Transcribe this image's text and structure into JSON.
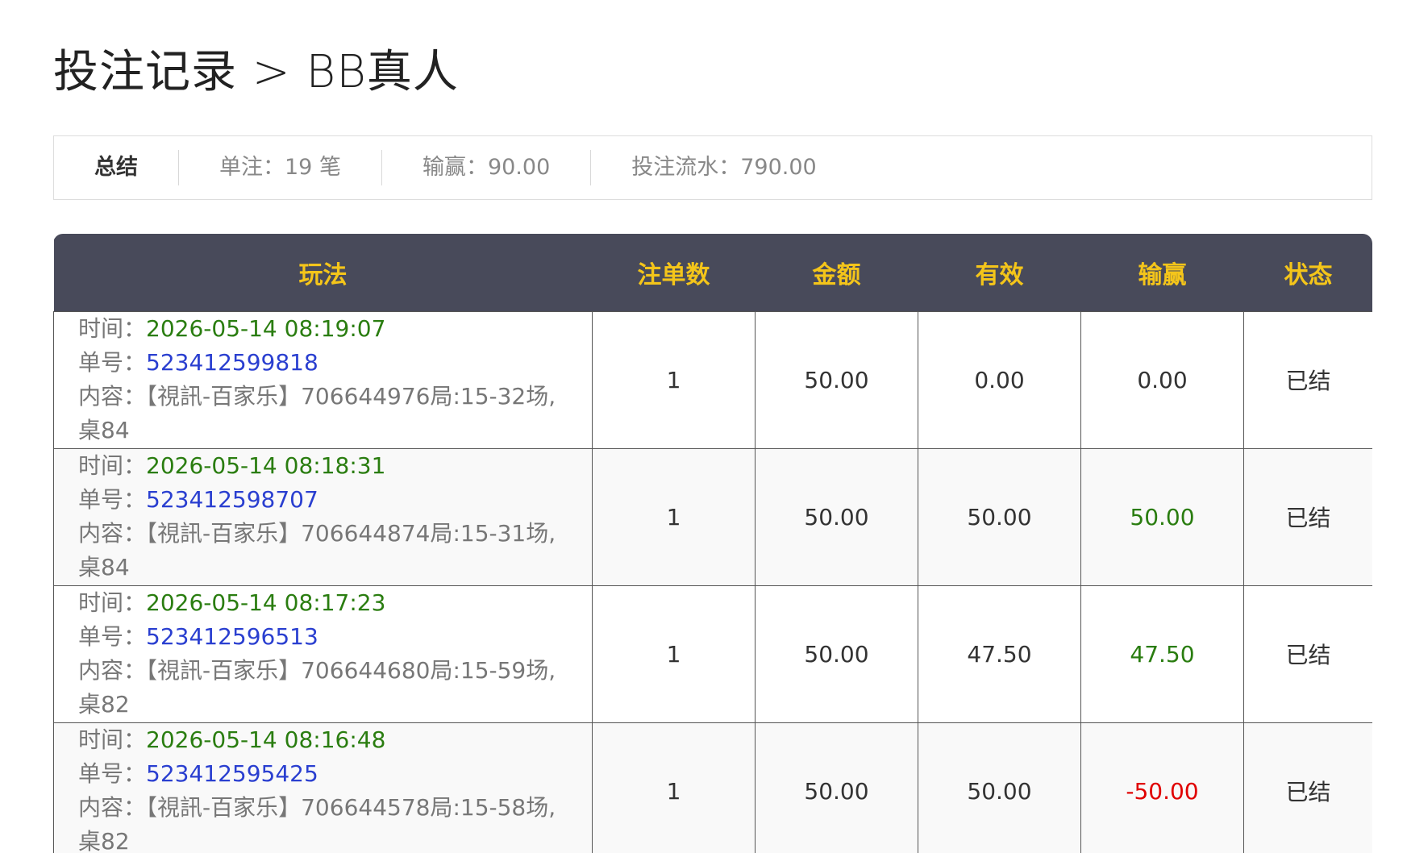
{
  "title": "投注记录 > BB真人",
  "summary": {
    "label": "总结",
    "count": "单注：19 笔",
    "winloss": "输赢：90.00",
    "turnover": "投注流水：790.00"
  },
  "table": {
    "headers": [
      "玩法",
      "注单数",
      "金额",
      "有效",
      "输赢",
      "状态"
    ],
    "time_label": "时间：",
    "no_label": "单号：",
    "content_label": "内容：",
    "rows": [
      {
        "time": "2026-05-14 08:19:07",
        "no": "523412599818",
        "content": "【視訊-百家乐】706644976局:15-32场,桌84",
        "count": "1",
        "amount": "50.00",
        "valid": "0.00",
        "winloss": "0.00",
        "winloss_color": "#333333",
        "status": "已结"
      },
      {
        "time": "2026-05-14 08:18:31",
        "no": "523412598707",
        "content": "【視訊-百家乐】706644874局:15-31场,桌84",
        "count": "1",
        "amount": "50.00",
        "valid": "50.00",
        "winloss": "50.00",
        "winloss_color": "#2a7d10",
        "status": "已结"
      },
      {
        "time": "2026-05-14 08:17:23",
        "no": "523412596513",
        "content": "【視訊-百家乐】706644680局:15-59场,桌82",
        "count": "1",
        "amount": "50.00",
        "valid": "47.50",
        "winloss": "47.50",
        "winloss_color": "#2a7d10",
        "status": "已结"
      },
      {
        "time": "2026-05-14 08:16:48",
        "no": "523412595425",
        "content": "【視訊-百家乐】706644578局:15-58场,桌82",
        "count": "1",
        "amount": "50.00",
        "valid": "50.00",
        "winloss": "-50.00",
        "winloss_color": "#e00000",
        "status": "已结"
      }
    ]
  }
}
